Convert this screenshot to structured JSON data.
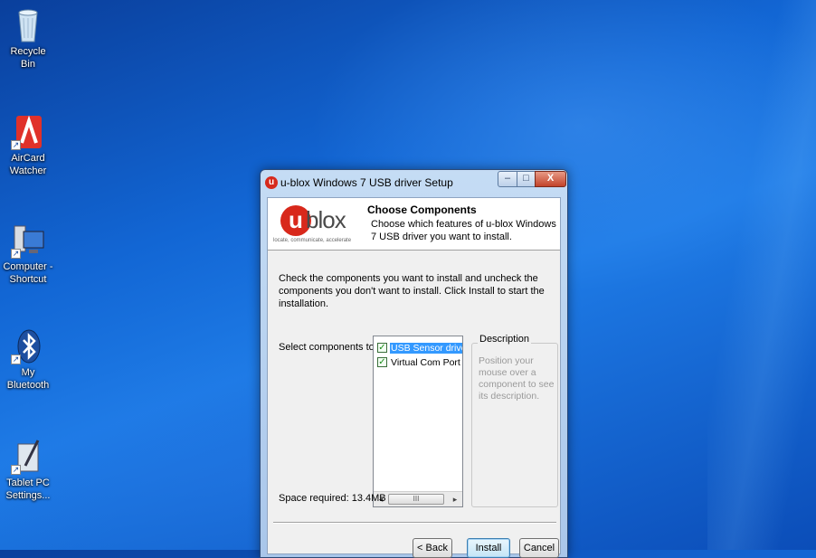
{
  "desktop": {
    "icons": [
      {
        "label": "Recycle Bin",
        "icon": "recycle-bin-icon"
      },
      {
        "label": "AirCard\nWatcher",
        "icon": "aircard-watcher-icon"
      },
      {
        "label": "Computer -\nShortcut",
        "icon": "computer-icon"
      },
      {
        "label": "My\nBluetooth",
        "icon": "bluetooth-icon"
      },
      {
        "label": "Tablet PC\nSettings...",
        "icon": "tablet-pc-settings-icon"
      }
    ]
  },
  "window": {
    "title": "u-blox Windows 7 USB driver Setup",
    "controls": {
      "minimize": "–",
      "maximize": "□",
      "close": "X"
    },
    "header": {
      "logo_letter": "u",
      "logo_word": "blox",
      "logo_tagline": "locate, communicate, accelerate",
      "title": "Choose Components",
      "subtitle": "Choose which features of u-blox Windows 7 USB driver you want to install."
    },
    "intro_text": "Check the components you want to install and uncheck the components you don't want to install. Click Install to start the installation.",
    "select_label": "Select components to install:",
    "components": [
      {
        "label": "USB Sensor driver files",
        "checked": true,
        "selected": true
      },
      {
        "label": "Virtual Com Port driver files",
        "checked": true,
        "selected": false
      }
    ],
    "scroll": {
      "left": "◂",
      "thumb": "III",
      "right": "▸"
    },
    "space_required": "Space required: 13.4MB",
    "description": {
      "legend": "Description",
      "text": "Position your mouse over a component to see its description."
    },
    "buttons": {
      "back": "< Back",
      "install": "Install",
      "cancel": "Cancel"
    }
  },
  "colors": {
    "accent": "#d8281b",
    "desktop": "#1266d4",
    "selection": "#3399ff"
  }
}
